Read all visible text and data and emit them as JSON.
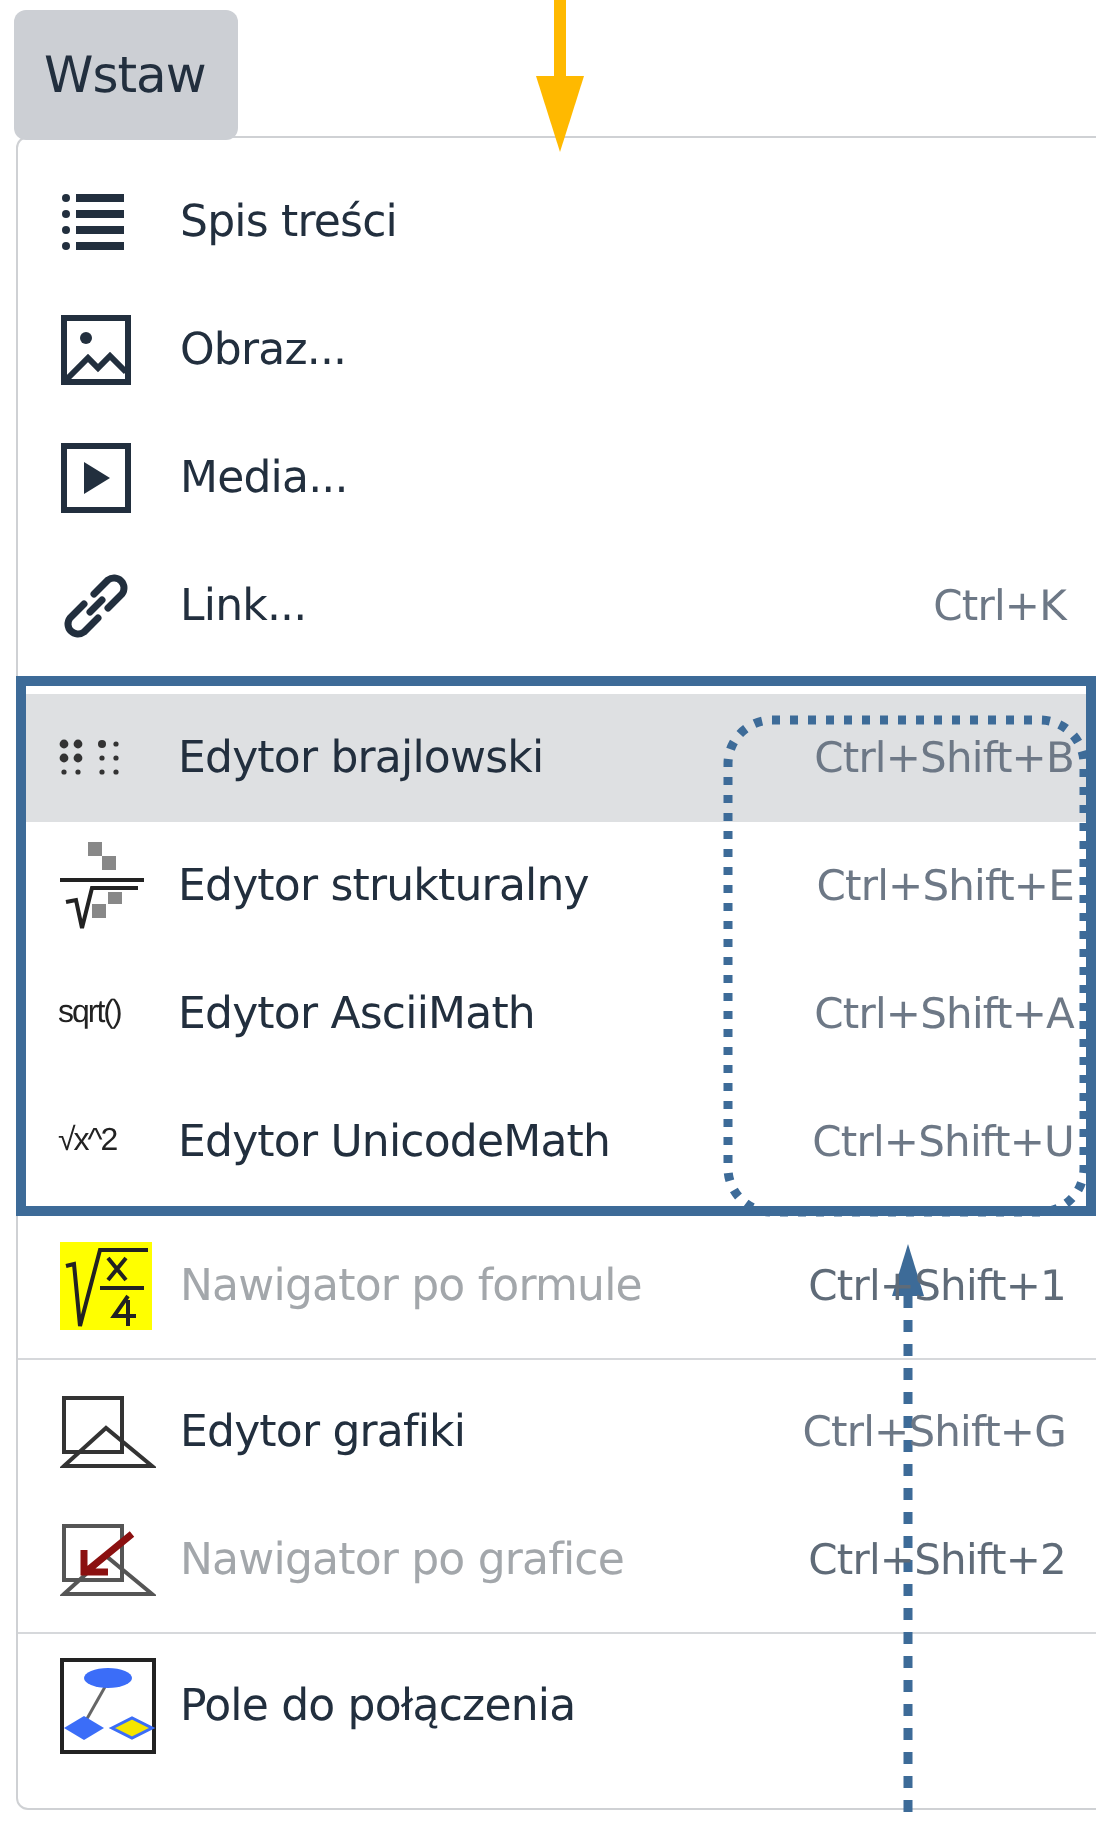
{
  "menubar": {
    "button": {
      "label": "Wstaw",
      "selected": true
    }
  },
  "menu": {
    "sections": [
      {
        "framed": false,
        "items": [
          {
            "kind": "list",
            "label": "Spis treści",
            "disabled": false,
            "selected": false
          },
          {
            "kind": "image",
            "label": "Obraz...",
            "disabled": false,
            "selected": false
          },
          {
            "kind": "media",
            "label": "Media...",
            "disabled": false,
            "selected": false
          },
          {
            "kind": "link",
            "label": "Link...",
            "shortcut": "Ctrl+K",
            "disabled": false,
            "selected": false
          }
        ]
      },
      {
        "framed": true,
        "items": [
          {
            "kind": "braille",
            "label": "Edytor brajlowski",
            "shortcut": "Ctrl+Shift+B",
            "disabled": false,
            "selected": true
          },
          {
            "kind": "structural",
            "label": "Edytor strukturalny",
            "shortcut": "Ctrl+Shift+E",
            "disabled": false,
            "selected": false
          },
          {
            "kind": "text",
            "icon_text": "sqrt()",
            "label": "Edytor AsciiMath",
            "shortcut": "Ctrl+Shift+A",
            "disabled": false,
            "selected": false
          },
          {
            "kind": "text",
            "icon_text": "√x^2",
            "label": "Edytor UnicodeMath",
            "shortcut": "Ctrl+Shift+U",
            "disabled": false,
            "selected": false
          }
        ]
      },
      {
        "framed": false,
        "items": [
          {
            "kind": "formula",
            "label": "Nawigator po formule",
            "shortcut": "Ctrl+Shift+1",
            "disabled": true,
            "selected": false
          }
        ]
      },
      {
        "framed": false,
        "items": [
          {
            "kind": "graphics",
            "label": "Edytor grafiki",
            "shortcut": "Ctrl+Shift+G",
            "disabled": false,
            "selected": false
          },
          {
            "kind": "graphics-nav",
            "label": "Nawigator po grafice",
            "shortcut": "Ctrl+Shift+2",
            "disabled": true,
            "selected": false
          }
        ]
      },
      {
        "framed": false,
        "items": [
          {
            "kind": "diagram",
            "label": "Pole do połączenia",
            "disabled": false,
            "selected": false
          }
        ]
      }
    ]
  },
  "annotations": [
    {
      "kind": "arrow-down"
    },
    {
      "kind": "dotted-frame"
    },
    {
      "kind": "dotted-arrow-up"
    }
  ]
}
